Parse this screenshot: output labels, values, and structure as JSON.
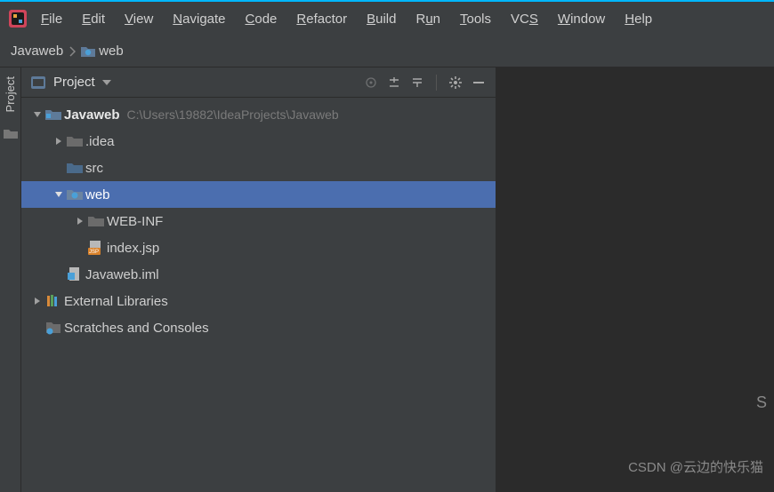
{
  "menubar": {
    "items": [
      "File",
      "Edit",
      "View",
      "Navigate",
      "Code",
      "Refactor",
      "Build",
      "Run",
      "Tools",
      "VCS",
      "Window",
      "Help"
    ]
  },
  "breadcrumb": {
    "root": "Javaweb",
    "child": "web"
  },
  "gutter": {
    "label": "Project"
  },
  "sidebar": {
    "title": "Project"
  },
  "tree": {
    "root": {
      "label": "Javaweb",
      "path": "C:\\Users\\19882\\IdeaProjects\\Javaweb"
    },
    "idea": {
      "label": ".idea"
    },
    "src": {
      "label": "src"
    },
    "web": {
      "label": "web"
    },
    "webinf": {
      "label": "WEB-INF"
    },
    "indexjsp": {
      "label": "index.jsp"
    },
    "iml": {
      "label": "Javaweb.iml"
    },
    "extlib": {
      "label": "External Libraries"
    },
    "scratch": {
      "label": "Scratches and Consoles"
    }
  },
  "editor": {
    "right_hint": "S"
  },
  "watermark": "CSDN @云边的快乐猫"
}
